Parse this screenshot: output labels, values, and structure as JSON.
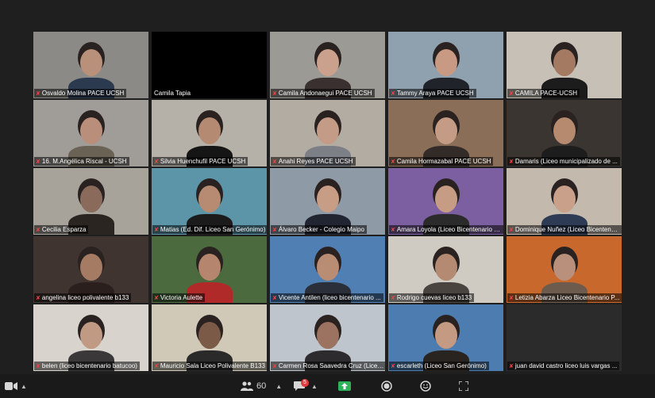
{
  "participants": [
    {
      "name": "Osvaldo Molina PACE UCSH",
      "muted": true,
      "bg": "#8b8a86",
      "skin": "#b9917a",
      "shirt": "#2c3a4f"
    },
    {
      "name": "Camila Tapia",
      "muted": false,
      "bg": "#000000",
      "skin": "",
      "shirt": "",
      "active": true
    },
    {
      "name": "Camila Andonaegui PACE UCSH",
      "muted": true,
      "bg": "#9c9a94",
      "skin": "#caa18c",
      "shirt": "#3b3030"
    },
    {
      "name": "Tammy Araya PACE UCSH",
      "muted": true,
      "bg": "#8fa1ae",
      "skin": "#c99a83",
      "shirt": "#20242a"
    },
    {
      "name": "CAMILA PACE-UCSH",
      "muted": true,
      "bg": "#c6c0b6",
      "skin": "#a57a63",
      "shirt": "#1c1c1c"
    },
    {
      "name": "16. M.Angélica Riscal - UCSH",
      "muted": true,
      "bg": "#a09c98",
      "skin": "#b98f7b",
      "shirt": "#6b6256"
    },
    {
      "name": "Silvia Huenchufil PACE UCSH",
      "muted": true,
      "bg": "#b6b1a8",
      "skin": "#b48a72",
      "shirt": "#151515"
    },
    {
      "name": "Anahi Reyes PACE UCSH",
      "muted": true,
      "bg": "#b3aca3",
      "skin": "#c49b86",
      "shirt": "#7d7f86"
    },
    {
      "name": "Camila Hormazabal PACE UCSH",
      "muted": true,
      "bg": "#8a6e58",
      "skin": "#c49c85",
      "shirt": "#322b28"
    },
    {
      "name": "Damaris (Liceo municipalizado de ...",
      "muted": true,
      "bg": "#3a3530",
      "skin": "#b58a6f",
      "shirt": "#1d1d1d"
    },
    {
      "name": "Cecilia Esparza",
      "muted": true,
      "bg": "#a7a39b",
      "skin": "#8a6a5a",
      "shirt": "#2a2520"
    },
    {
      "name": "Matias (Ed. Dif. Liceo San Gerónimo)",
      "muted": true,
      "bg": "#5c95a8",
      "skin": "#b68b72",
      "shirt": "#1b1b1b"
    },
    {
      "name": "Álvaro Becker - Colegio Maipo",
      "muted": true,
      "bg": "#8e9aa6",
      "skin": "#c79d86",
      "shirt": "#202531"
    },
    {
      "name": "Amara Loyola (Liceo Bicentenario D...",
      "muted": true,
      "bg": "#7b5fa0",
      "skin": "#c79c84",
      "shirt": "#2b2b2b"
    },
    {
      "name": "Dominique Nuñez (Liceo Bicentenar...",
      "muted": true,
      "bg": "#c3b9ad",
      "skin": "#c9a08a",
      "shirt": "#2d3b55"
    },
    {
      "name": "angelina liceo polivalente b133",
      "muted": true,
      "bg": "#3f3430",
      "skin": "#a67b64",
      "shirt": "#2a1f1c"
    },
    {
      "name": "Victoria Aulette",
      "muted": true,
      "bg": "#4b6b3f",
      "skin": "#b6856e",
      "shirt": "#b12a2a"
    },
    {
      "name": "Vicente Antilen (liceo bicentenario ...",
      "muted": true,
      "bg": "#4f7fb3",
      "skin": "#b98c74",
      "shirt": "#2a2f3a"
    },
    {
      "name": "Rodrigo cuevas liceo b133",
      "muted": true,
      "bg": "#cfcac2",
      "skin": "#b48a72",
      "shirt": "#4a4440"
    },
    {
      "name": "Letizia Abarza Liceo Bicentenario P...",
      "muted": true,
      "bg": "#c8682c",
      "skin": "#b9907b",
      "shirt": "#6d5b4d"
    },
    {
      "name": "belen (liceo bicentenario batucoo)",
      "muted": true,
      "bg": "#d8d4cd",
      "skin": "#c19a84",
      "shirt": "#3a3838"
    },
    {
      "name": "Mauricio Sala Liceo Polivalente B133",
      "muted": true,
      "bg": "#d1c9b8",
      "skin": "#7b5a48",
      "shirt": "#2a2a2a"
    },
    {
      "name": "Carmen Rosa Saavedra Cruz (Liceo...",
      "muted": true,
      "bg": "#bfc5cc",
      "skin": "#9c7360",
      "shirt": "#2d2b2e"
    },
    {
      "name": "escarleth (Liceo San Gerónimo)",
      "muted": true,
      "bg": "#4d7db0",
      "skin": "#c49a82",
      "shirt": "#2a2421"
    },
    {
      "name": "juan david castro liceo luis vargas ...",
      "muted": true,
      "bg": "#2b2b2b",
      "skin": "",
      "shirt": ""
    }
  ],
  "toolbar": {
    "participants_count": "60",
    "chat_badge": "5"
  }
}
